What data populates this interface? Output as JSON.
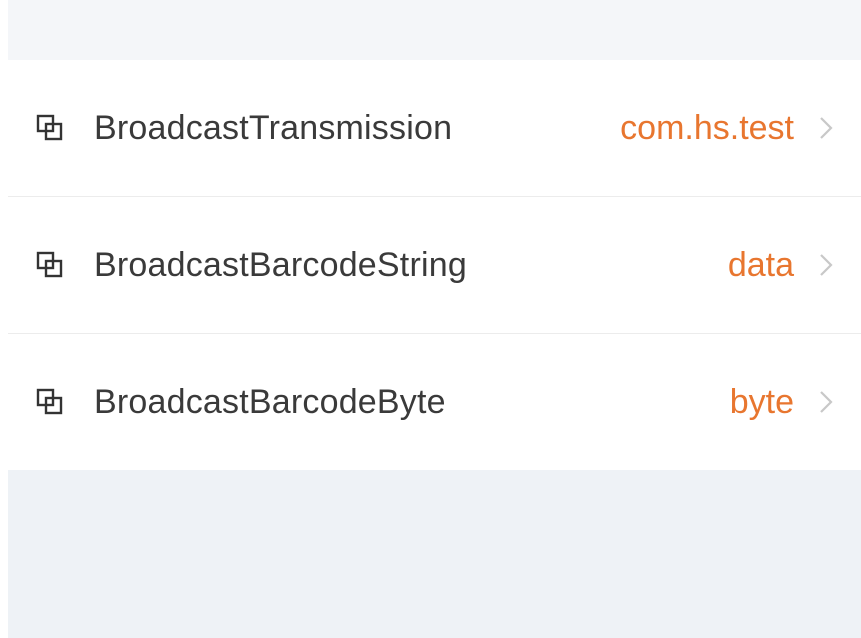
{
  "settings": {
    "items": [
      {
        "icon": "overlap-squares-icon",
        "label": "BroadcastTransmission",
        "value": "com.hs.test"
      },
      {
        "icon": "overlap-squares-icon",
        "label": "BroadcastBarcodeString",
        "value": "data"
      },
      {
        "icon": "overlap-squares-icon",
        "label": "BroadcastBarcodeByte",
        "value": "byte"
      }
    ]
  },
  "colors": {
    "value_accent": "#e8762f",
    "label_text": "#3a3a3a",
    "chevron": "#c8c8c8",
    "background": "#eef2f6"
  }
}
